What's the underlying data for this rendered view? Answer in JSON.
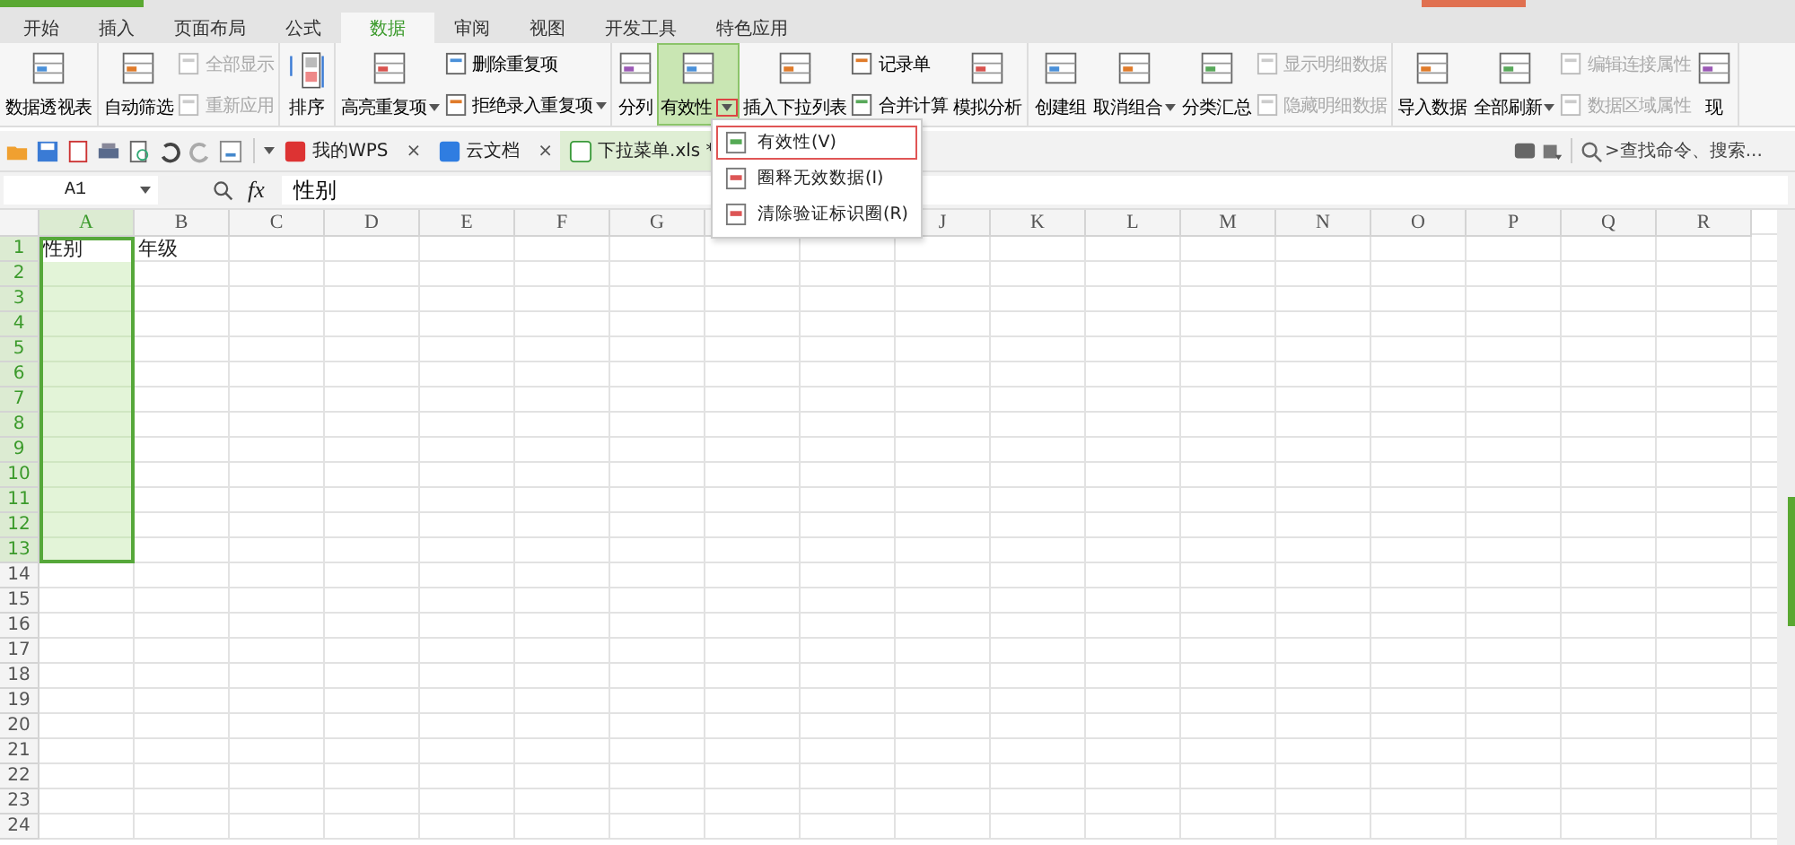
{
  "menu_tabs": [
    {
      "label": "开始",
      "selected": false
    },
    {
      "label": "插入",
      "selected": false
    },
    {
      "label": "页面布局",
      "selected": false
    },
    {
      "label": "公式",
      "selected": false
    },
    {
      "label": "数据",
      "selected": true
    },
    {
      "label": "审阅",
      "selected": false
    },
    {
      "label": "视图",
      "selected": false
    },
    {
      "label": "开发工具",
      "selected": false
    },
    {
      "label": "特色应用",
      "selected": false
    }
  ],
  "ribbon": [
    {
      "items": [
        {
          "kind": "large",
          "label": "数据透视表",
          "dropdown": false,
          "selected": false
        }
      ]
    },
    {
      "items": [
        {
          "kind": "large",
          "label": "自动筛选",
          "dropdown": false,
          "selected": false
        },
        {
          "kind": "stack",
          "items": [
            {
              "label": "全部显示",
              "disabled": true
            },
            {
              "label": "重新应用",
              "disabled": true
            }
          ]
        }
      ]
    },
    {
      "items": [
        {
          "kind": "sort",
          "label": "排序"
        }
      ]
    },
    {
      "items": [
        {
          "kind": "large",
          "label": "高亮重复项",
          "dropdown": true,
          "selected": false
        },
        {
          "kind": "stack",
          "items": [
            {
              "label": "删除重复项",
              "disabled": false
            },
            {
              "label": "拒绝录入重复项",
              "disabled": false,
              "dropdown": true
            }
          ]
        }
      ]
    },
    {
      "items": [
        {
          "kind": "large",
          "label": "分列",
          "dropdown": false,
          "selected": false
        },
        {
          "kind": "large",
          "label": "有效性",
          "dropdown": true,
          "selected": true
        },
        {
          "kind": "large",
          "label": "插入下拉列表",
          "dropdown": false,
          "selected": false
        },
        {
          "kind": "stack",
          "items": [
            {
              "label": "记录单",
              "disabled": false
            },
            {
              "label": "合并计算",
              "disabled": false
            }
          ]
        },
        {
          "kind": "large",
          "label": "模拟分析",
          "dropdown": false,
          "selected": false
        }
      ]
    },
    {
      "items": [
        {
          "kind": "large",
          "label": "创建组",
          "dropdown": false,
          "selected": false
        },
        {
          "kind": "large",
          "label": "取消组合",
          "dropdown": true,
          "selected": false
        },
        {
          "kind": "large",
          "label": "分类汇总",
          "dropdown": false,
          "selected": false
        },
        {
          "kind": "stack",
          "items": [
            {
              "label": "显示明细数据",
              "disabled": true
            },
            {
              "label": "隐藏明细数据",
              "disabled": true
            }
          ]
        }
      ]
    },
    {
      "items": [
        {
          "kind": "large",
          "label": "导入数据",
          "dropdown": false,
          "selected": false
        },
        {
          "kind": "large",
          "label": "全部刷新",
          "dropdown": true,
          "selected": false
        },
        {
          "kind": "stack",
          "items": [
            {
              "label": "编辑连接属性",
              "disabled": true
            },
            {
              "label": "数据区域属性",
              "disabled": true
            }
          ]
        },
        {
          "kind": "large",
          "label": "现",
          "dropdown": false,
          "selected": false
        }
      ]
    }
  ],
  "validity_menu": [
    {
      "label": "有效性(V)",
      "selected": true
    },
    {
      "label": "圈释无效数据(I)",
      "selected": false
    },
    {
      "label": "清除验证标识圈(R)",
      "selected": false
    }
  ],
  "doc_tabs": [
    {
      "label": "我的WPS",
      "close": "×",
      "selected": false
    },
    {
      "label": "云文档",
      "close": "×",
      "selected": false
    },
    {
      "label": "下拉菜单.xls *",
      "selected": true
    }
  ],
  "command_search": {
    "placeholder": ">查找命令、搜索..."
  },
  "formula_bar": {
    "name_box": "A1",
    "fx": "fx",
    "value": "性别"
  },
  "sheet": {
    "columns": [
      {
        "label": "A",
        "selected": true
      },
      {
        "label": "B",
        "selected": false
      },
      {
        "label": "C",
        "selected": false
      },
      {
        "label": "D",
        "selected": false
      },
      {
        "label": "E",
        "selected": false
      },
      {
        "label": "F",
        "selected": false
      },
      {
        "label": "G",
        "selected": false
      },
      {},
      {},
      {
        "label": "J",
        "selected": false
      },
      {
        "label": "K",
        "selected": false
      },
      {
        "label": "L",
        "selected": false
      },
      {
        "label": "M",
        "selected": false
      },
      {
        "label": "N",
        "selected": false
      },
      {
        "label": "O",
        "selected": false
      },
      {
        "label": "P",
        "selected": false
      },
      {
        "label": "Q",
        "selected": false
      },
      {
        "label": "R",
        "selected": false
      }
    ],
    "rows": [
      {
        "label": "1",
        "selected": true,
        "active": true,
        "cells": [
          "性别",
          "年级"
        ]
      },
      {
        "label": "2",
        "selected": true
      },
      {
        "label": "3",
        "selected": true
      },
      {
        "label": "4",
        "selected": true
      },
      {
        "label": "5",
        "selected": true
      },
      {
        "label": "6",
        "selected": true
      },
      {
        "label": "7",
        "selected": true
      },
      {
        "label": "8",
        "selected": true
      },
      {
        "label": "9",
        "selected": true
      },
      {
        "label": "10",
        "selected": true
      },
      {
        "label": "11",
        "selected": true
      },
      {
        "label": "12",
        "selected": true
      },
      {
        "label": "13",
        "selected": true
      },
      {
        "label": "14",
        "selected": false
      },
      {
        "label": "15",
        "selected": false
      },
      {
        "label": "16",
        "selected": false
      },
      {
        "label": "17",
        "selected": false
      },
      {
        "label": "18",
        "selected": false
      },
      {
        "label": "19",
        "selected": false
      },
      {
        "label": "20",
        "selected": false
      },
      {
        "label": "21",
        "selected": false
      },
      {
        "label": "22",
        "selected": false
      },
      {
        "label": "23",
        "selected": false
      },
      {
        "label": "24",
        "selected": false
      }
    ]
  }
}
